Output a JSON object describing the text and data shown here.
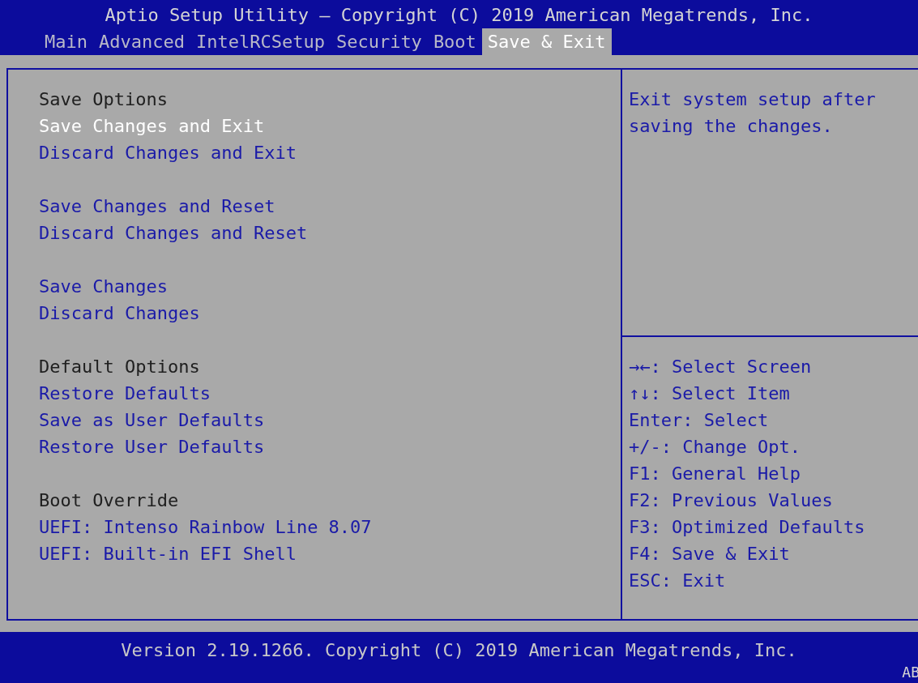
{
  "title": "Aptio Setup Utility – Copyright (C) 2019 American Megatrends, Inc.",
  "tabs": [
    {
      "label": "Main",
      "selected": false
    },
    {
      "label": "Advanced",
      "selected": false
    },
    {
      "label": "IntelRCSetup",
      "selected": false
    },
    {
      "label": "Security",
      "selected": false
    },
    {
      "label": "Boot",
      "selected": false
    },
    {
      "label": "Save & Exit",
      "selected": true
    }
  ],
  "menu_groups": [
    [
      {
        "kind": "header",
        "label": "Save Options",
        "selected": false
      },
      {
        "kind": "action",
        "label": "Save Changes and Exit",
        "selected": true
      },
      {
        "kind": "action",
        "label": "Discard Changes and Exit",
        "selected": false
      }
    ],
    [
      {
        "kind": "action",
        "label": "Save Changes and Reset",
        "selected": false
      },
      {
        "kind": "action",
        "label": "Discard Changes and Reset",
        "selected": false
      }
    ],
    [
      {
        "kind": "action",
        "label": "Save Changes",
        "selected": false
      },
      {
        "kind": "action",
        "label": "Discard Changes",
        "selected": false
      }
    ],
    [
      {
        "kind": "header",
        "label": "Default Options",
        "selected": false
      },
      {
        "kind": "action",
        "label": "Restore Defaults",
        "selected": false
      },
      {
        "kind": "action",
        "label": "Save as User Defaults",
        "selected": false
      },
      {
        "kind": "action",
        "label": "Restore User Defaults",
        "selected": false
      }
    ],
    [
      {
        "kind": "header",
        "label": "Boot Override",
        "selected": false
      },
      {
        "kind": "action",
        "label": "UEFI: Intenso Rainbow Line 8.07",
        "selected": false
      },
      {
        "kind": "action",
        "label": "UEFI: Built-in EFI Shell",
        "selected": false
      }
    ]
  ],
  "help_text": "Exit system setup after saving the changes.",
  "key_help": [
    {
      "key": "→←",
      "label": ": Select Screen"
    },
    {
      "key": "↑↓",
      "label": ": Select Item"
    },
    {
      "key": "Enter",
      "label": ": Select"
    },
    {
      "key": "+/-",
      "label": ": Change Opt."
    },
    {
      "key": "F1",
      "label": ": General Help"
    },
    {
      "key": "F2",
      "label": ": Previous Values"
    },
    {
      "key": "F3",
      "label": ": Optimized Defaults"
    },
    {
      "key": "F4",
      "label": ": Save & Exit"
    },
    {
      "key": "ESC",
      "label": ": Exit"
    }
  ],
  "footer": {
    "version": "Version 2.19.1266. Copyright (C) 2019 American Megatrends, Inc.",
    "corner": "AB"
  }
}
